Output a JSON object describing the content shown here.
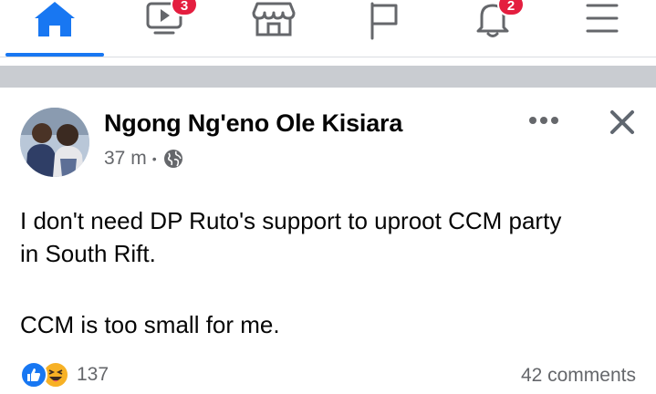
{
  "nav": {
    "items": [
      {
        "name": "home",
        "icon": "home-icon",
        "active": true
      },
      {
        "name": "watch",
        "icon": "watch-icon",
        "badge": "3"
      },
      {
        "name": "marketplace",
        "icon": "marketplace-icon"
      },
      {
        "name": "pages",
        "icon": "flag-icon"
      },
      {
        "name": "notifications",
        "icon": "bell-icon",
        "badge": "2"
      },
      {
        "name": "menu",
        "icon": "menu-icon"
      }
    ]
  },
  "post": {
    "author": "Ngong Ng'eno Ole Kisiara",
    "time": "37 m",
    "privacy_icon": "globe-icon",
    "text_line1": "I don't need DP Ruto's support to uproot CCM party",
    "text_line2": "in South Rift.",
    "text_line3": "CCM is too small for me.",
    "reaction_count": "137",
    "comments": "42 comments"
  },
  "colors": {
    "accent": "#1877f2",
    "badge": "#e41e3f",
    "secondary_text": "#65676b",
    "separator": "#c9ccd1"
  }
}
